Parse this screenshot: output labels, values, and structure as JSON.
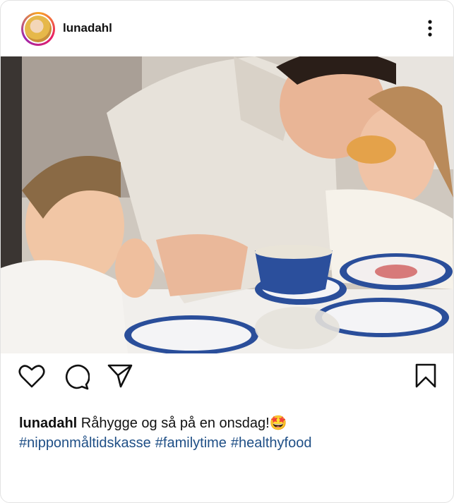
{
  "post": {
    "username": "lunadahl",
    "caption_user": "lunadahl",
    "caption_text": " Råhygge og så på en onsdag!",
    "caption_emoji": "🤩",
    "hashtags": [
      "#nipponmåltidskasse",
      "#familytime",
      "#healthyfood"
    ]
  },
  "icons": {
    "more": "more-vertical-icon",
    "like": "heart-icon",
    "comment": "comment-icon",
    "share": "send-icon",
    "save": "bookmark-icon"
  },
  "colors": {
    "hashtag": "#1f4f86",
    "text": "#111111",
    "avatar_ring": "#e91e63"
  }
}
